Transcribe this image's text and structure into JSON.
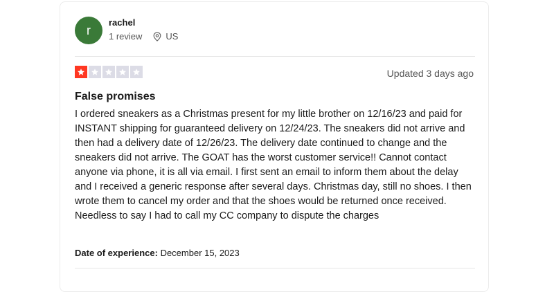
{
  "reviewer": {
    "initial": "r",
    "name": "rachel",
    "review_count": "1 review",
    "country": "US",
    "avatar_color": "#3a7a38"
  },
  "rating": {
    "stars": 1,
    "max": 5,
    "filled_color": "#ff3722",
    "empty_color": "#dcdce6"
  },
  "updated": "Updated 3 days ago",
  "review": {
    "title": "False promises",
    "body": "I ordered sneakers as a Christmas present for my little brother on 12/16/23 and paid for INSTANT shipping for guaranteed delivery on 12/24/23. The sneakers did not arrive and then had a delivery date of 12/26/23. The delivery date continued to change and the sneakers did not arrive. The GOAT has the worst customer service!! Cannot contact anyone via phone, it is all via email. I first sent an email to inform them about the delay and I received a generic response after several days. Christmas day, still no shoes. I then wrote them to cancel my order and that the shoes would be returned once received. Needless to say I had to call my CC company to dispute the charges"
  },
  "experience": {
    "label": "Date of experience:",
    "date": "December 15, 2023"
  },
  "icons": {
    "location": "map-pin-icon",
    "star": "star-icon"
  }
}
